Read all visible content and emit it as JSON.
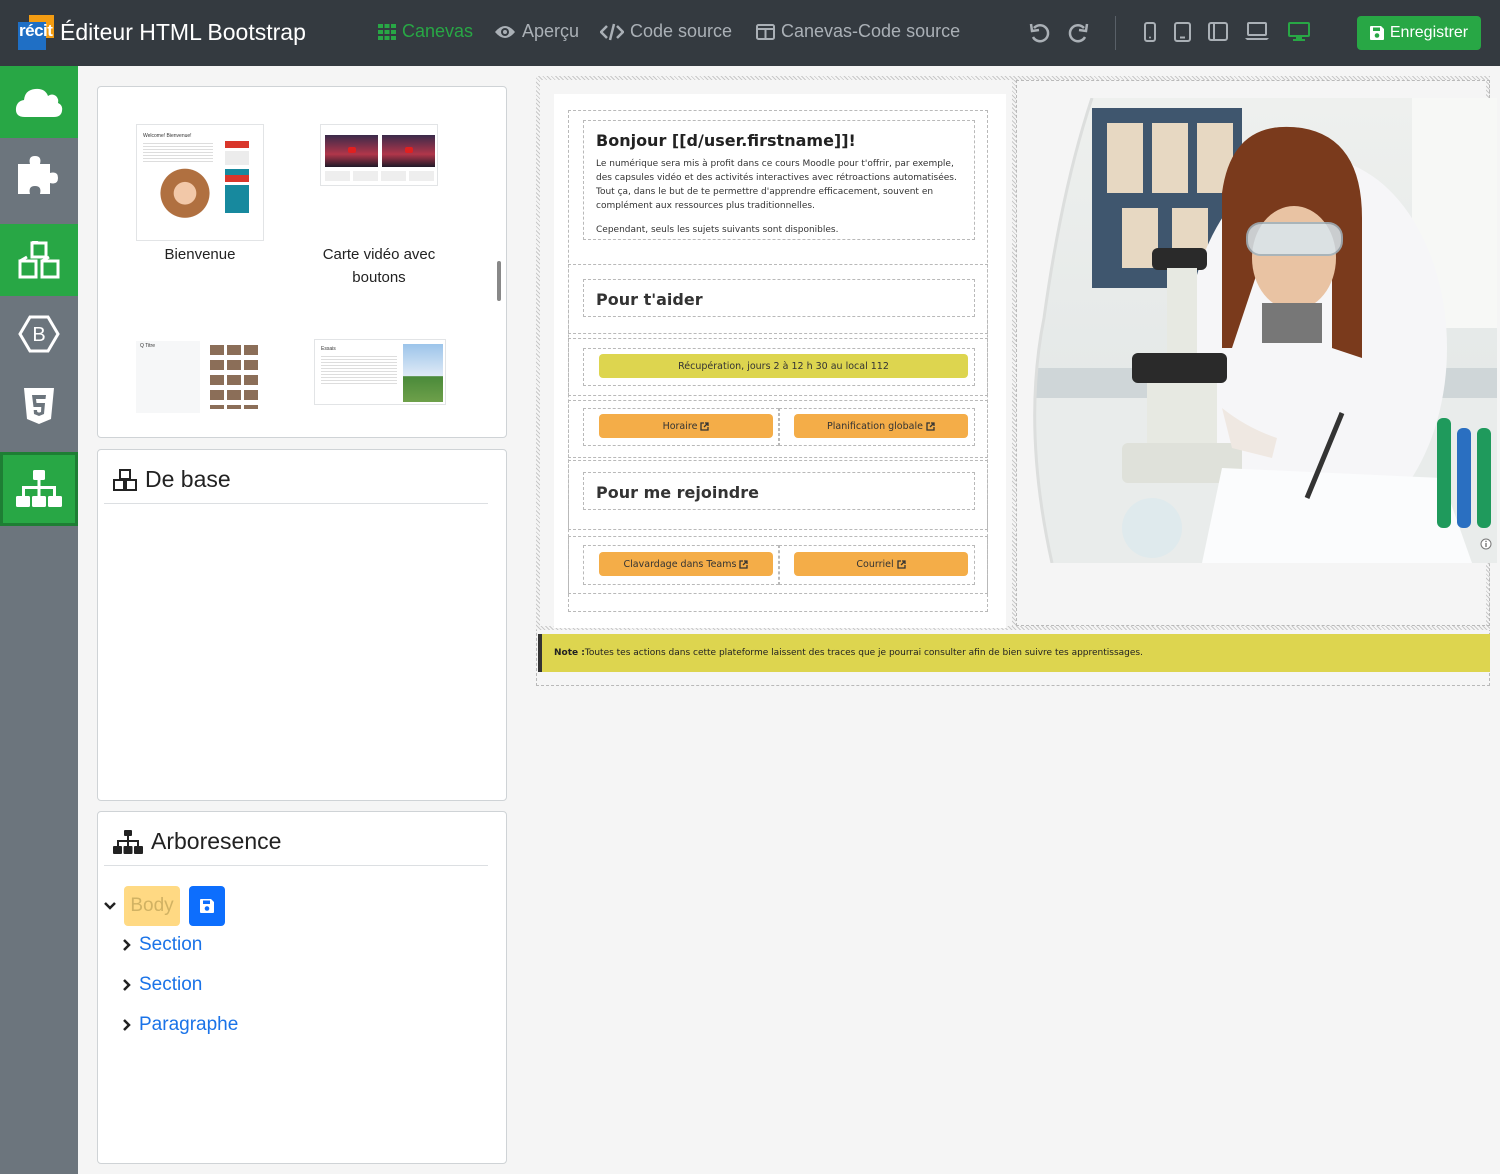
{
  "app": {
    "logo_text": "récit",
    "title": "Éditeur HTML Bootstrap"
  },
  "toolbar": {
    "views": [
      {
        "label": "Canevas",
        "icon": "grid-icon",
        "active": true
      },
      {
        "label": "Aperçu",
        "icon": "eye-icon",
        "active": false
      },
      {
        "label": "Code source",
        "icon": "code-icon",
        "active": false
      },
      {
        "label": "Canevas-Code source",
        "icon": "split-view-icon",
        "active": false
      }
    ],
    "devices": [
      "phone-icon",
      "tablet-icon",
      "tablet-landscape-icon",
      "laptop-icon",
      "desktop-icon"
    ],
    "save_label": "Enregistrer"
  },
  "sidebar": {
    "buttons": [
      "cloud-icon",
      "puzzle-icon",
      "cubes-icon",
      "bootstrap-icon",
      "html5-icon",
      "sitemap-icon"
    ]
  },
  "templates": {
    "items": [
      {
        "label": "Bienvenue"
      },
      {
        "label": "Carte vidéo avec boutons"
      },
      {
        "label": ""
      },
      {
        "label": ""
      }
    ],
    "thumb_texts": {
      "welcome_title": "Welcome! Bienvenue!",
      "grid_title": "Q Titre",
      "essai": "Essais"
    }
  },
  "basics_panel": {
    "title": "De base"
  },
  "tree_panel": {
    "title": "Arboresence",
    "root": "Body",
    "children": [
      "Section",
      "Section",
      "Paragraphe"
    ]
  },
  "canvas": {
    "greeting": "Bonjour [[d/user.firstname]]!",
    "paragraph1": "Le numérique sera mis à profit dans ce cours Moodle pour t'offrir, par exemple, des capsules vidéo et des activités interactives avec rétroactions automatisées. Tout ça, dans le but de te permettre d'apprendre efficacement, souvent en complément aux ressources plus traditionnelles.",
    "paragraph2": "Cependant, seuls les sujets suivants sont disponibles.",
    "section_help": "Pour t'aider",
    "recuperation": "Récupération, jours 2 à 12 h 30 au local 112",
    "horaire": "Horaire",
    "planification": "Planification globale",
    "section_join": "Pour me rejoindre",
    "teams": "Clavardage dans Teams",
    "courriel": "Courriel",
    "note_label": "Note :",
    "note_text": " Toutes tes actions dans cette plateforme laissent des traces que je pourrai consulter afin de bien suivre tes apprentissages."
  },
  "colors": {
    "green": "#28a745",
    "topbar": "#343a40",
    "yellow": "#ddd54f",
    "orange": "#f4ad48",
    "link": "#1a73e8"
  }
}
